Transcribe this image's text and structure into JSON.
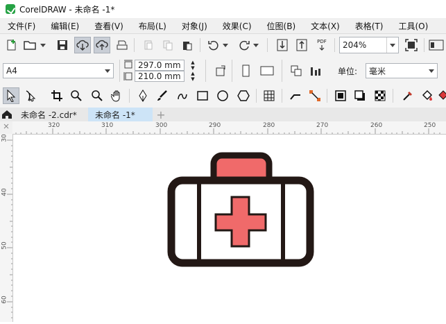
{
  "window": {
    "title": "CorelDRAW - 未命名 -1*"
  },
  "menu": [
    "文件(F)",
    "编辑(E)",
    "查看(V)",
    "布局(L)",
    "对象(J)",
    "效果(C)",
    "位图(B)",
    "文本(X)",
    "表格(T)",
    "工具(O)"
  ],
  "toolbar1": {
    "zoom_value": "204%",
    "pdf_label": "PDF"
  },
  "propertybar": {
    "page_size": "A4",
    "width_value": "297.0 mm",
    "height_value": "210.0 mm",
    "unit_label": "单位:",
    "unit_value": "毫米"
  },
  "tabs": [
    {
      "label": "未命名 -2.cdr*"
    },
    {
      "label": "未命名 -1*"
    }
  ],
  "ruler_h": [
    "320",
    "310",
    "300",
    "290",
    "280",
    "270",
    "260",
    "250"
  ],
  "ruler_v": [
    "30",
    "40",
    "50",
    "60"
  ],
  "drawing": {
    "outline_color": "#231815",
    "fill_red": "#f06a6a",
    "body_fill": "#ffffff"
  }
}
